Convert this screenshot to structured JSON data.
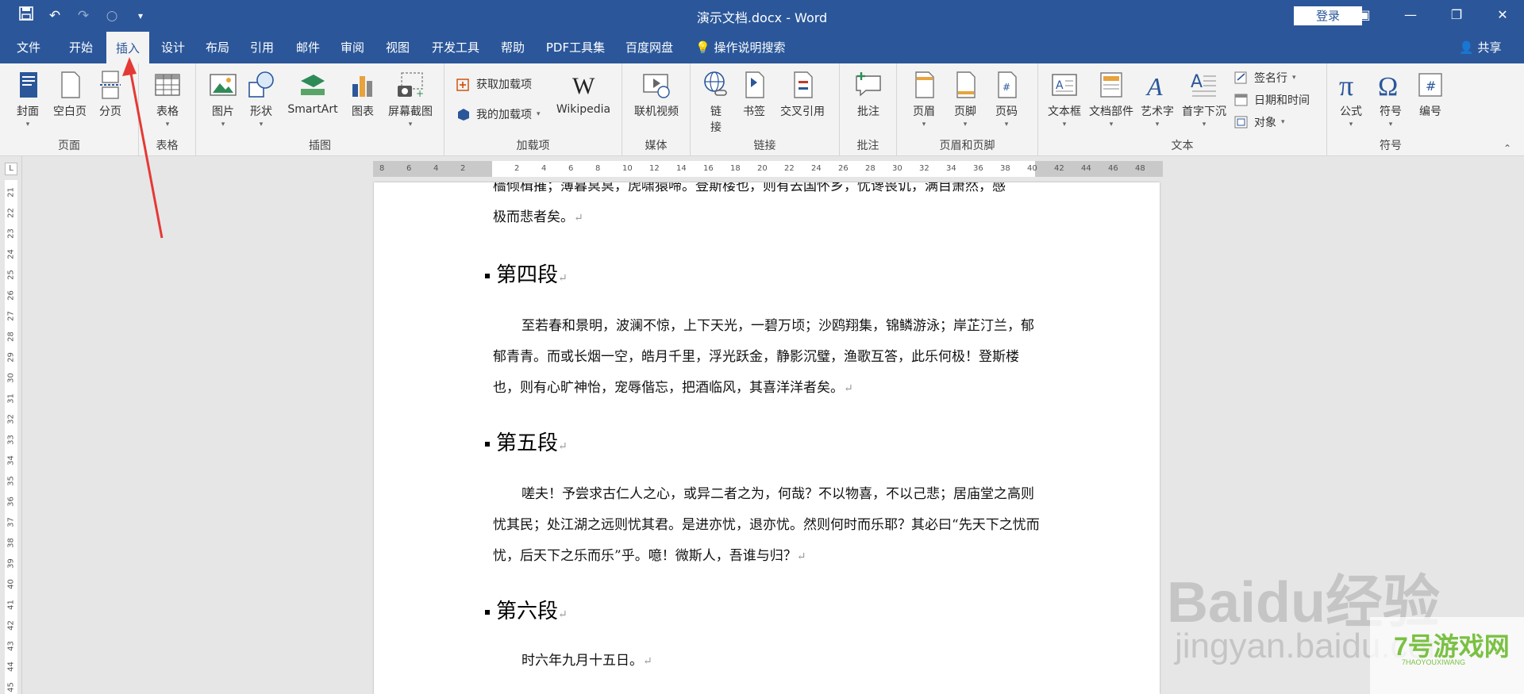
{
  "window": {
    "title": "演示文档.docx  -  Word",
    "login_label": "登录"
  },
  "tabs": [
    "文件",
    "开始",
    "插入",
    "设计",
    "布局",
    "引用",
    "邮件",
    "审阅",
    "视图",
    "开发工具",
    "帮助",
    "PDF工具集",
    "百度网盘"
  ],
  "active_tab": "插入",
  "tell_me": "操作说明搜索",
  "share_label": "共享",
  "ribbon": {
    "pages": {
      "label": "页面",
      "cover": "封面",
      "blank": "空白页",
      "break": "分页"
    },
    "tables": {
      "label": "表格",
      "table": "表格"
    },
    "illustrations": {
      "label": "插图",
      "picture": "图片",
      "shapes": "形状",
      "smartart": "SmartArt",
      "chart": "图表",
      "screenshot": "屏幕截图"
    },
    "addins": {
      "label": "加载项",
      "get": "获取加载项",
      "mine": "我的加载项",
      "wikipedia": "Wikipedia"
    },
    "media": {
      "label": "媒体",
      "video": "联机视频"
    },
    "links": {
      "label": "链接",
      "link_1": "链",
      "link_2": "接",
      "bookmark": "书签",
      "crossref": "交叉引用"
    },
    "comments": {
      "label": "批注",
      "comment": "批注"
    },
    "header_footer": {
      "label": "页眉和页脚",
      "header": "页眉",
      "footer": "页脚",
      "page_number": "页码"
    },
    "text": {
      "label": "文本",
      "textbox": "文本框",
      "quickparts": "文档部件",
      "wordart": "艺术字",
      "dropcap": "首字下沉",
      "signature": "签名行",
      "datetime": "日期和时间",
      "object": "对象"
    },
    "symbols": {
      "label": "符号",
      "equation": "公式",
      "symbol": "符号",
      "number": "编号"
    }
  },
  "vruler_numbers": [
    "21",
    "22",
    "23",
    "24",
    "25",
    "26",
    "27",
    "28",
    "29",
    "30",
    "31",
    "32",
    "33",
    "34",
    "35",
    "36",
    "37",
    "38",
    "39",
    "40",
    "41",
    "42",
    "43",
    "44",
    "45"
  ],
  "hruler_numbers": [
    "8",
    "6",
    "4",
    "2",
    "",
    "2",
    "4",
    "6",
    "8",
    "10",
    "12",
    "14",
    "16",
    "18",
    "20",
    "22",
    "24",
    "26",
    "28",
    "30",
    "32",
    "34",
    "36",
    "38",
    "40",
    "42",
    "44",
    "46",
    "48"
  ],
  "document": {
    "p1_line1": "樯倾楫摧；薄暮冥冥，虎啸猿啼。登斯楼也，则有去国怀乡，忧谗畏讥，满目萧然，感",
    "p1_line2": "极而悲者矣。",
    "h4": "第四段",
    "p4": "至若春和景明，波澜不惊，上下天光，一碧万顷；沙鸥翔集，锦鳞游泳；岸芷汀兰，郁郁青青。而或长烟一空，皓月千里，浮光跃金，静影沉璧，渔歌互答，此乐何极！登斯楼也，则有心旷神怡，宠辱偕忘，把酒临风，其喜洋洋者矣。",
    "h5": "第五段",
    "p5": "嗟夫！予尝求古仁人之心，或异二者之为，何哉？不以物喜，不以己悲；居庙堂之高则忧其民；处江湖之远则忧其君。是进亦忧，退亦忧。然则何时而乐耶？其必曰“先天下之忧而忧，后天下之乐而乐”乎。噫！微斯人，吾谁与归？",
    "h6": "第六段",
    "p6": "时六年九月十五日。",
    "para_mark": "↵"
  },
  "watermark": {
    "baidu": "Baidu经验",
    "jingyan": "jingyan.baidu.com",
    "logo": "7号游戏网",
    "logo_sub": "7HAOYOUXIWANG"
  }
}
